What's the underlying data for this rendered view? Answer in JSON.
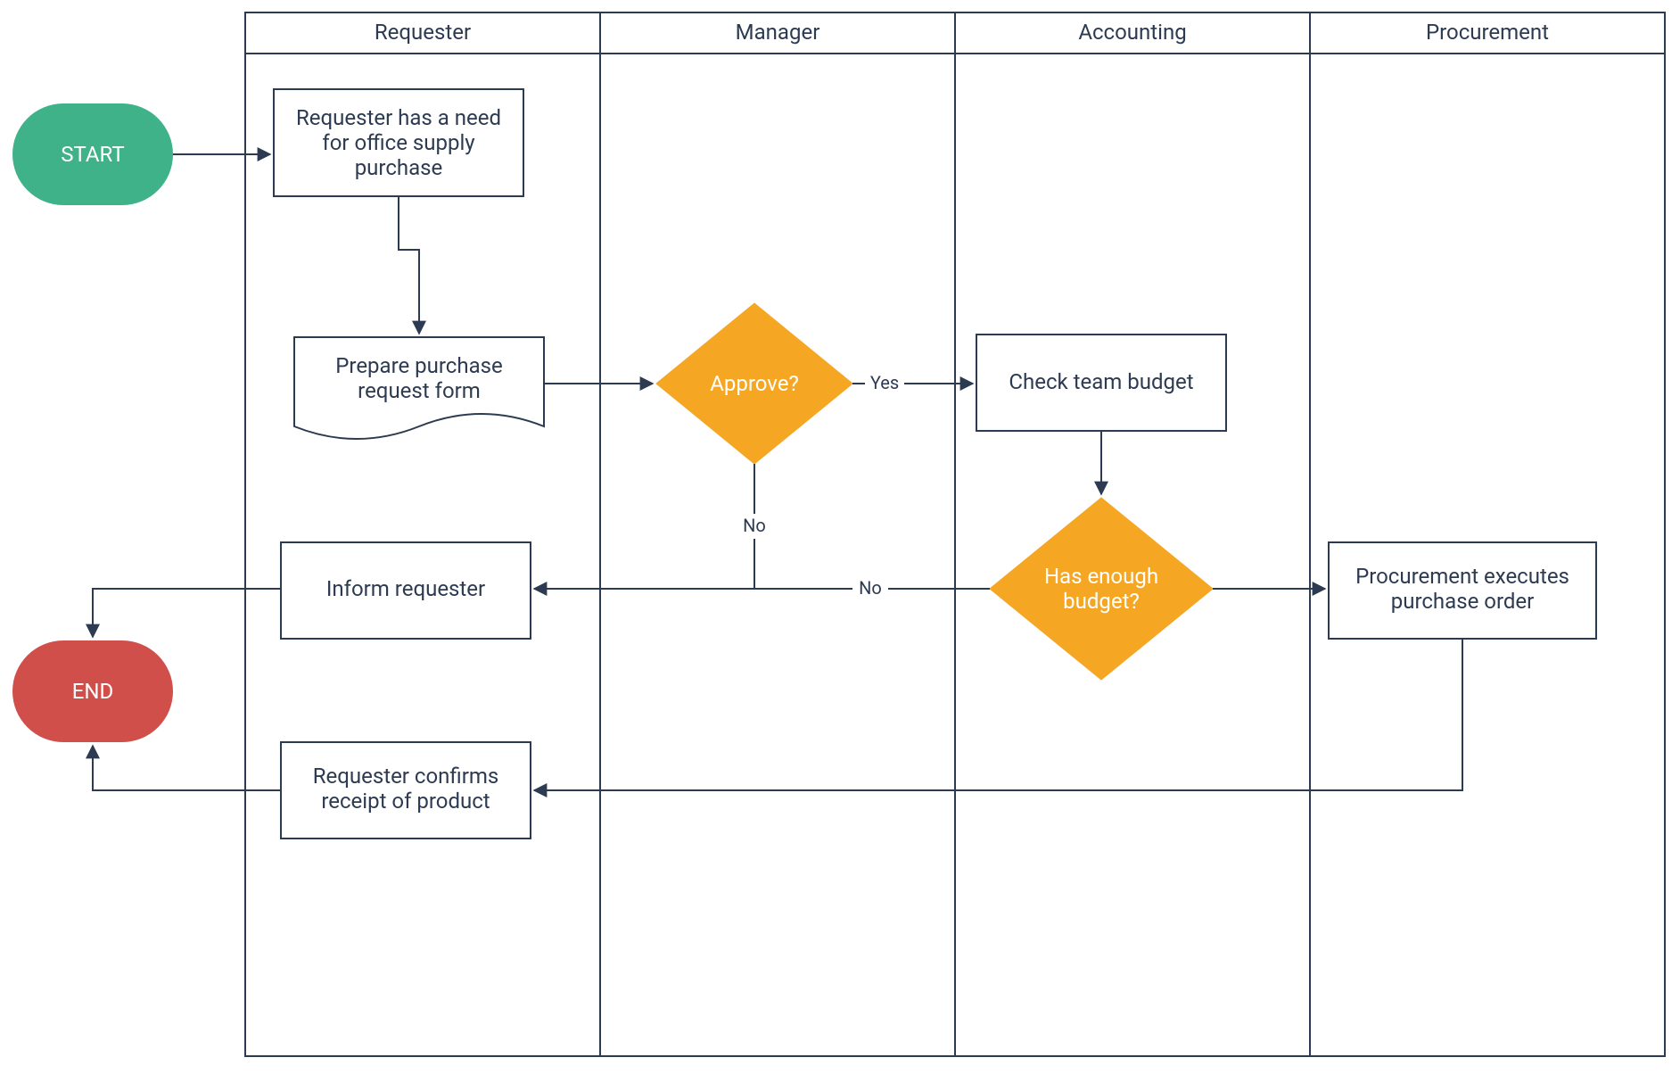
{
  "colors": {
    "stroke": "#2d3b52",
    "start": "#3fb28a",
    "end": "#d14f4a",
    "decision": "#f5a623",
    "white": "#ffffff"
  },
  "lanes": [
    {
      "id": "requester",
      "label": "Requester"
    },
    {
      "id": "manager",
      "label": "Manager"
    },
    {
      "id": "accounting",
      "label": "Accounting"
    },
    {
      "id": "procurement",
      "label": "Procurement"
    }
  ],
  "terminators": {
    "start": {
      "label": "START"
    },
    "end": {
      "label": "END"
    }
  },
  "nodes": {
    "need": {
      "lines": [
        "Requester has a need",
        "for office supply",
        "purchase"
      ]
    },
    "prepare": {
      "lines": [
        "Prepare purchase",
        "request form"
      ]
    },
    "approve": {
      "lines": [
        "Approve?"
      ]
    },
    "checkBudget": {
      "lines": [
        "Check team budget"
      ]
    },
    "hasBudget": {
      "lines": [
        "Has enough",
        "budget?"
      ]
    },
    "inform": {
      "lines": [
        "Inform requester"
      ]
    },
    "execute": {
      "lines": [
        "Procurement executes",
        "purchase order"
      ]
    },
    "confirm": {
      "lines": [
        "Requester confirms",
        "receipt of product"
      ]
    }
  },
  "edgeLabels": {
    "approveYes": "Yes",
    "approveNo": "No",
    "budgetNo": "No"
  }
}
